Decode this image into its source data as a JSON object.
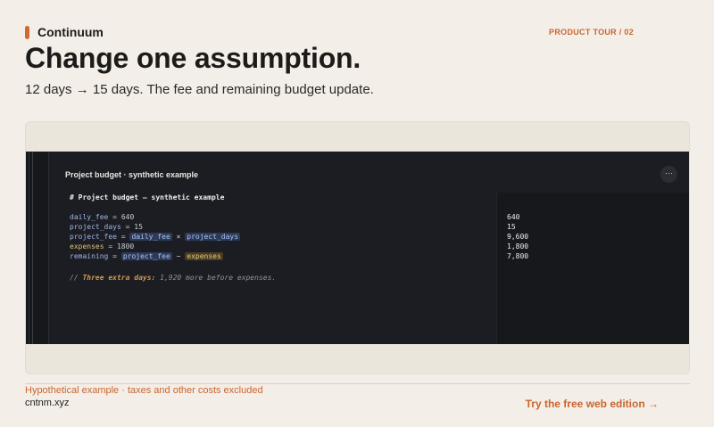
{
  "brand": {
    "name": "Continuum"
  },
  "tour_label": "PRODUCT TOUR / 02",
  "headline": "Change one assumption.",
  "subhead": "12 days → 15 days. The fee and remaining budget update.",
  "app": {
    "doc_title": "Project budget · synthetic example",
    "menu_label": "···",
    "heading_comment": "# Project budget — synthetic example",
    "lines": [
      {
        "name": "daily_fee",
        "eq": " = ",
        "value": "640"
      },
      {
        "name": "project_days",
        "eq": " = ",
        "value": "15"
      },
      {
        "name": "project_fee",
        "eq": " = ",
        "ref1": "daily_fee",
        "op": " × ",
        "ref2": "project_days"
      },
      {
        "name": "expenses",
        "eq": " = ",
        "value": "1800"
      },
      {
        "name": "remaining",
        "eq": " = ",
        "ref1": "project_fee",
        "op": " − ",
        "ref2": "expenses"
      }
    ],
    "note_prefix": "// ",
    "note_highlight": "Three extra days:",
    "note_rest": " 1,920 more before expenses.",
    "results": [
      "640",
      "15",
      "9,600",
      "1,800",
      "7,800"
    ]
  },
  "footer": {
    "disclaimer": "Hypothetical example · taxes and other costs excluded",
    "domain": "cntnm.xyz",
    "cta": "Try the free web edition →"
  },
  "colors": {
    "accent": "#c9652f",
    "background": "#f3efe8",
    "editor": "#1b1d22"
  }
}
